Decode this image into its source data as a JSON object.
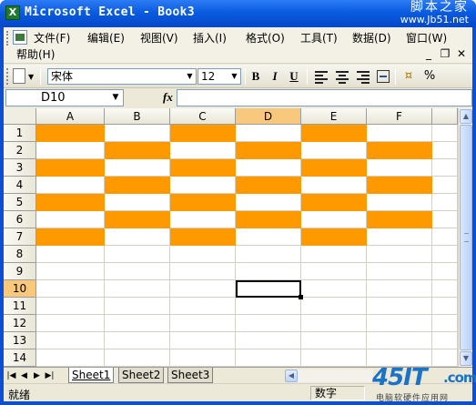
{
  "window": {
    "title": "Microsoft Excel - Book3",
    "app_icon": "X",
    "watermark_top_line1": "脚本之家",
    "watermark_top_line2": "www.Jb51.net"
  },
  "menu": {
    "items": [
      {
        "label": "文件(F)"
      },
      {
        "label": "编辑(E)"
      },
      {
        "label": "视图(V)"
      },
      {
        "label": "插入(I)"
      },
      {
        "label": "格式(O)"
      },
      {
        "label": "工具(T)"
      },
      {
        "label": "数据(D)"
      },
      {
        "label": "窗口(W)"
      },
      {
        "label": "帮助(H)"
      }
    ],
    "window_controls": {
      "minimize": "_",
      "restore": "❐",
      "close": "✕"
    }
  },
  "toolbar": {
    "font_name": "宋体",
    "font_size": "12",
    "bold": "B",
    "italic": "I",
    "underline": "U",
    "percent": "%",
    "icons": [
      "new-document-icon",
      "align-left-icon",
      "align-center-icon",
      "align-right-icon",
      "merge-center-icon",
      "currency-icon",
      "percent-icon"
    ]
  },
  "formula_bar": {
    "name_box": "D10",
    "fx_label": "fx",
    "formula": ""
  },
  "sheet": {
    "columns": [
      "A",
      "B",
      "C",
      "D",
      "E",
      "F"
    ],
    "rows": [
      "1",
      "2",
      "3",
      "4",
      "5",
      "6",
      "7",
      "8",
      "9",
      "10",
      "11",
      "12",
      "13",
      "14"
    ],
    "active_cell": "D10",
    "active_column": "D",
    "active_row": "10",
    "fill_color": "#ff9900",
    "filled_cells": [
      [
        1,
        0,
        1,
        0,
        1,
        0
      ],
      [
        0,
        1,
        0,
        1,
        0,
        1
      ],
      [
        1,
        0,
        1,
        0,
        1,
        0
      ],
      [
        0,
        1,
        0,
        1,
        0,
        1
      ],
      [
        1,
        0,
        1,
        0,
        1,
        0
      ],
      [
        0,
        1,
        0,
        1,
        0,
        1
      ],
      [
        1,
        0,
        1,
        0,
        1,
        0
      ]
    ]
  },
  "tabs": {
    "sheets": [
      "Sheet1",
      "Sheet2",
      "Sheet3"
    ],
    "active": "Sheet1"
  },
  "status": {
    "ready": "就绪",
    "mode": "数字"
  },
  "watermark_bottom": {
    "logo": "45IT",
    "logo_cn": ".com",
    "subtitle": "电脑软硬件应用网"
  }
}
